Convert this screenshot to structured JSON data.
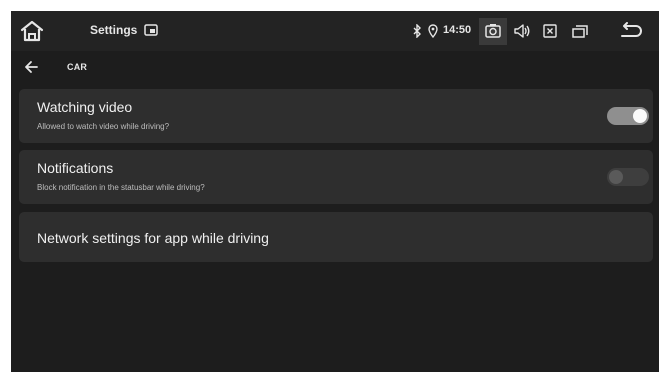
{
  "statusbar": {
    "title": "Settings",
    "time": "14:50",
    "icons": [
      "home-icon",
      "app-window-icon",
      "bluetooth-icon",
      "location-icon",
      "screenshot-icon",
      "volume-icon",
      "close-box-icon",
      "window-icon",
      "back-return-icon"
    ]
  },
  "header": {
    "title": "CAR",
    "back_icon": "left-arrow-icon"
  },
  "settings": [
    {
      "title": "Watching video",
      "subtitle": "Allowed to watch video while driving?",
      "toggle_on": true
    },
    {
      "title": "Notifications",
      "subtitle": "Block notification in the statusbar while driving?",
      "toggle_on": false
    },
    {
      "title": "Network settings for app while driving"
    }
  ],
  "colors": {
    "background": "#1d1d1d",
    "card": "#2e2e2e",
    "toggle_on_track": "#8f8f8f",
    "toggle_off_track": "#3e3e3e"
  }
}
